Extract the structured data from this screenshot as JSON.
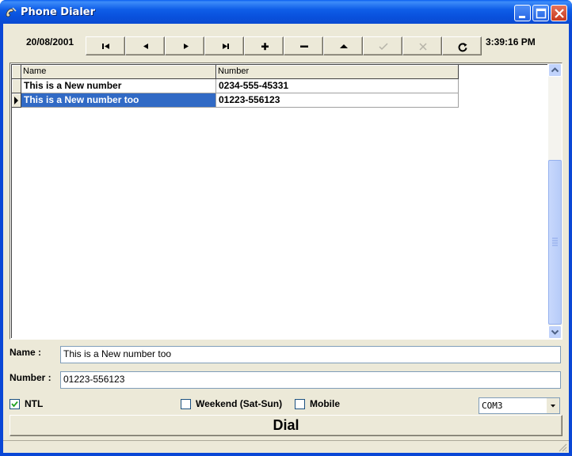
{
  "window": {
    "title": "Phone Dialer",
    "title_color": "#0a47d6"
  },
  "toolbar": {
    "date": "20/08/2001",
    "time": "3:39:16 PM",
    "nav_buttons": [
      {
        "icon": "first-record-icon",
        "enabled": true
      },
      {
        "icon": "prior-record-icon",
        "enabled": true
      },
      {
        "icon": "next-record-icon",
        "enabled": true
      },
      {
        "icon": "last-record-icon",
        "enabled": true
      },
      {
        "icon": "insert-record-icon",
        "enabled": true
      },
      {
        "icon": "delete-record-icon",
        "enabled": true
      },
      {
        "icon": "edit-record-icon",
        "enabled": true
      },
      {
        "icon": "post-record-icon",
        "enabled": false
      },
      {
        "icon": "cancel-record-icon",
        "enabled": false
      },
      {
        "icon": "refresh-icon",
        "enabled": true
      }
    ]
  },
  "grid": {
    "columns": [
      "Name",
      "Number"
    ],
    "rows": [
      {
        "name": "This is a New number",
        "number": "0234-555-45331"
      },
      {
        "name": "This is a New number too",
        "number": "01223-556123"
      }
    ],
    "selected_row": 1,
    "selection_color": "#316ac5"
  },
  "form": {
    "name_label": "Name :",
    "name_value": "This is a New number too",
    "number_label": "Number :",
    "number_value": "01223-556123"
  },
  "options": {
    "ntl_label": "NTL",
    "ntl_checked": true,
    "weekend_label": "Weekend (Sat-Sun)",
    "weekend_checked": false,
    "mobile_label": "Mobile",
    "mobile_checked": false,
    "port_value": "COM3"
  },
  "dial_label": "Dial"
}
